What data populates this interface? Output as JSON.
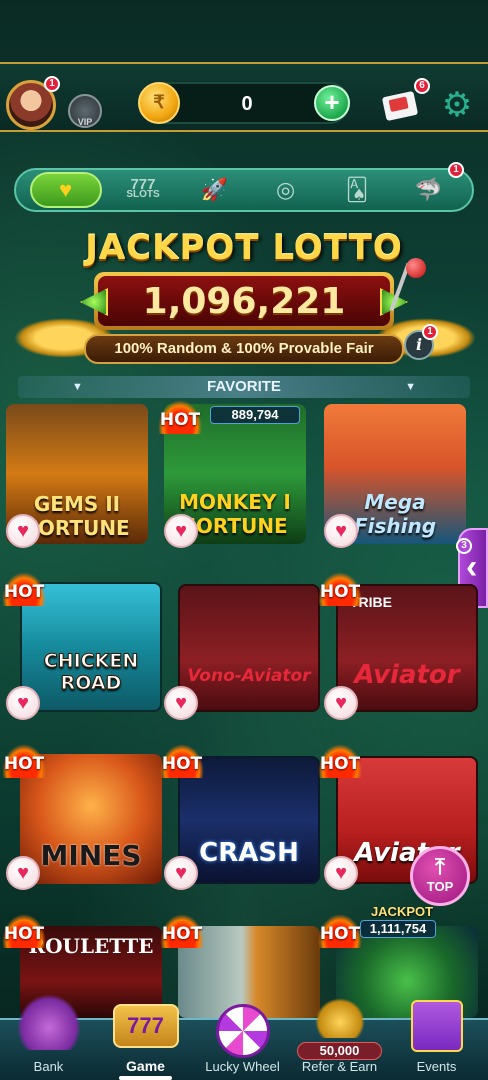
{
  "topbar": {
    "avatar_badge": "1",
    "vip_label": "VIP",
    "balance": "0",
    "mail_badge": "6"
  },
  "categories": {
    "slots_label": "SLOTS",
    "slots_number": "777",
    "badge": "1"
  },
  "jackpot": {
    "title": "JACKPOT LOTTO",
    "amount": "1,096,221",
    "subtitle": "100% Random & 100% Provable Fair",
    "info_badge": "1"
  },
  "favorite": {
    "label": "FAVORITE"
  },
  "games": [
    {
      "name": "GEMS II FORTUNE",
      "hot": false
    },
    {
      "name": "MONKEY I FORTUNE",
      "hot": true,
      "hot_label": "HOT",
      "jackpot_value": "889,794"
    },
    {
      "name": "Mega Fishing",
      "hot": false
    },
    {
      "name": "CHICKEN ROAD",
      "hot": true,
      "hot_label": "HOT"
    },
    {
      "name": "Vono-Aviator",
      "hot": false
    },
    {
      "name": "Aviator",
      "hot": true,
      "hot_label": "HOT",
      "tag": "TRIBE"
    },
    {
      "name": "MINES",
      "hot": true,
      "hot_label": "HOT"
    },
    {
      "name": "CRASH",
      "hot": true,
      "hot_label": "HOT"
    },
    {
      "name": "Aviator",
      "hot": true,
      "hot_label": "HOT"
    },
    {
      "name": "ROULETTE",
      "hot": true,
      "hot_label": "HOT"
    },
    {
      "name": "",
      "hot": true,
      "hot_label": "HOT"
    },
    {
      "name": "",
      "hot": true,
      "hot_label": "HOT",
      "jackpot_label": "JACKPOT",
      "jackpot_value": "1,111,754"
    }
  ],
  "side_badge": "3",
  "top_button": "TOP",
  "bottom_nav": [
    {
      "label": "Bank"
    },
    {
      "label": "Game",
      "active": true
    },
    {
      "label": "Lucky Wheel"
    },
    {
      "label": "Refer & Earn",
      "amount": "50,000"
    },
    {
      "label": "Events"
    }
  ],
  "colors": {
    "accent_gold": "#ffd84a",
    "heart": "#e8285c",
    "top_button": "#c7309d",
    "plus_button": "#1da74c"
  }
}
